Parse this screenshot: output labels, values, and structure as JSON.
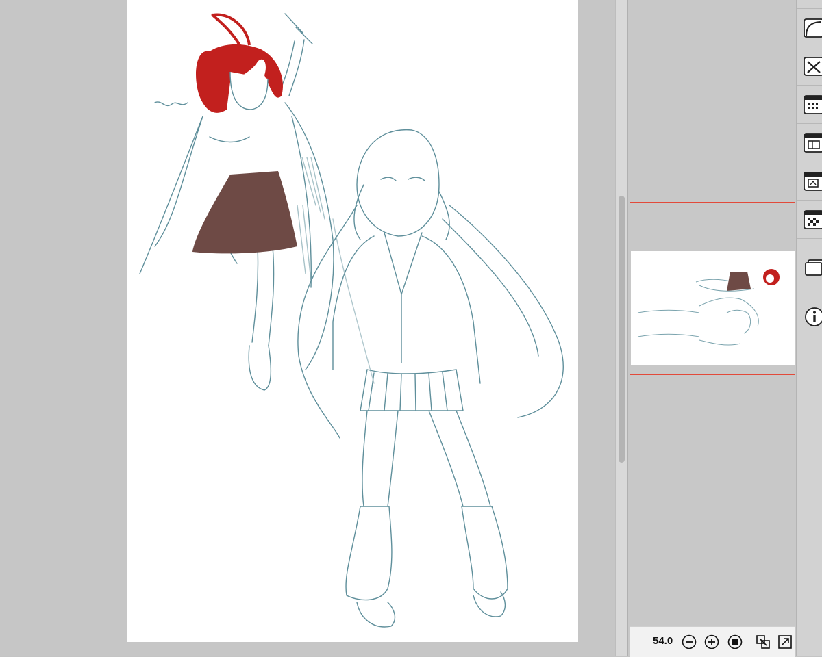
{
  "navigator": {
    "zoom_value": "54.0"
  },
  "icons": {
    "zoom_out": "zoom-out-icon",
    "zoom_in": "zoom-in-icon",
    "fit": "fit-to-window-icon",
    "rotate_left": "rotate-left-icon",
    "rotate_right": "rotate-right-icon",
    "panels": [
      "ruler-panel-icon",
      "close-panel-icon",
      "grid-panel-icon",
      "layout-panel-icon",
      "frame-panel-icon",
      "transparency-panel-icon",
      "layers-panel-icon",
      "info-icon"
    ]
  },
  "colors": {
    "workspace": "#c6c6c6",
    "canvas": "#ffffff",
    "viewport_frame": "#e24a3a",
    "line_art": "#5f8f9b",
    "hair_red": "#c2201e",
    "skirt_brown": "#6e4a45"
  }
}
